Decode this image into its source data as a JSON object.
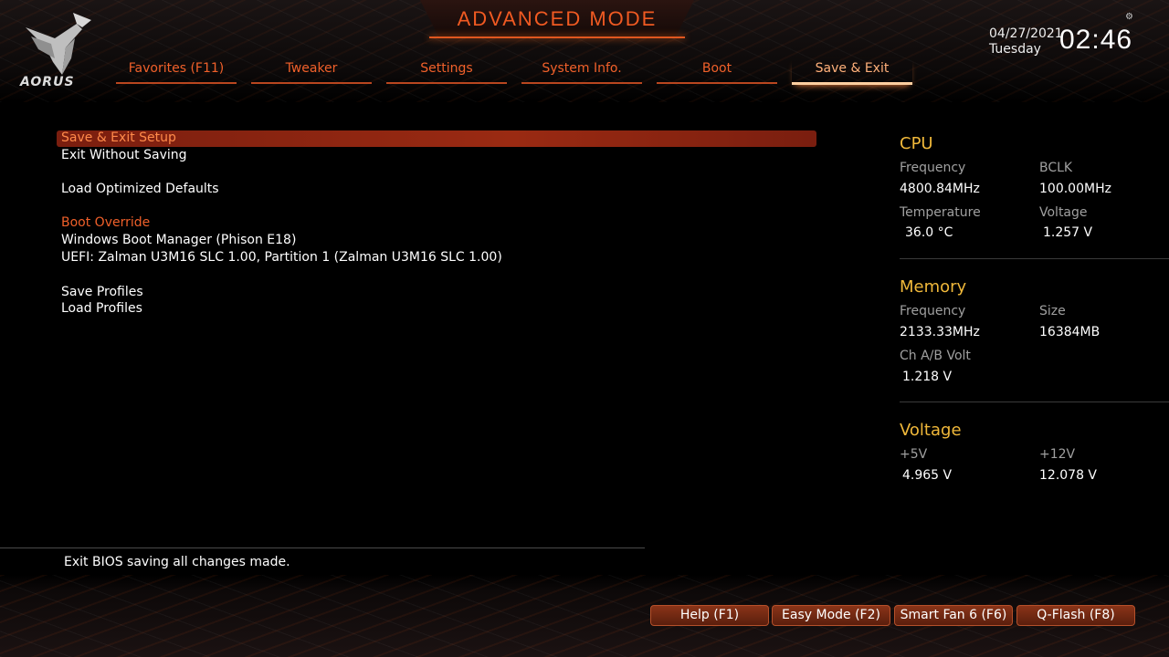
{
  "header": {
    "title": "ADVANCED MODE",
    "logo_text": "AORUS",
    "date": "04/27/2021",
    "day": "Tuesday",
    "time": "02:46",
    "settings_glyph": "⚙"
  },
  "tabs": [
    {
      "label": "Favorites (F11)",
      "active": false
    },
    {
      "label": "Tweaker",
      "active": false
    },
    {
      "label": "Settings",
      "active": false
    },
    {
      "label": "System Info.",
      "active": false
    },
    {
      "label": "Boot",
      "active": false
    },
    {
      "label": "Save & Exit",
      "active": true
    }
  ],
  "menu": {
    "save_exit_setup": "Save & Exit Setup",
    "exit_without_saving": "Exit Without Saving",
    "load_optimized_defaults": "Load Optimized Defaults",
    "boot_override_header": "Boot Override",
    "boot_option_1": "Windows Boot Manager (Phison E18)",
    "boot_option_2": "UEFI: Zalman U3M16 SLC 1.00, Partition 1 (Zalman U3M16 SLC 1.00)",
    "save_profiles": "Save Profiles",
    "load_profiles": "Load Profiles"
  },
  "help_text": "Exit BIOS saving all changes made.",
  "monitor": {
    "cpu": {
      "title": "CPU",
      "frequency_label": "Frequency",
      "frequency_value": "4800.84MHz",
      "bclk_label": "BCLK",
      "bclk_value": "100.00MHz",
      "temperature_label": "Temperature",
      "temperature_value": "36.0 °C",
      "voltage_label": "Voltage",
      "voltage_value": "1.257 V"
    },
    "memory": {
      "title": "Memory",
      "frequency_label": "Frequency",
      "frequency_value": "2133.33MHz",
      "size_label": "Size",
      "size_value": "16384MB",
      "chab_volt_label": "Ch A/B Volt",
      "chab_volt_value": "1.218 V"
    },
    "voltage": {
      "title": "Voltage",
      "v5_label": "+5V",
      "v5_value": "4.965 V",
      "v12_label": "+12V",
      "v12_value": "12.078 V"
    }
  },
  "function_buttons": {
    "help": "Help (F1)",
    "easy_mode": "Easy Mode (F2)",
    "smart_fan": "Smart Fan 6 (F6)",
    "qflash": "Q-Flash (F8)"
  },
  "colors": {
    "accent_orange": "#f0602a",
    "section_gold": "#f0b83a",
    "selection_bar": "#9a2a12"
  }
}
